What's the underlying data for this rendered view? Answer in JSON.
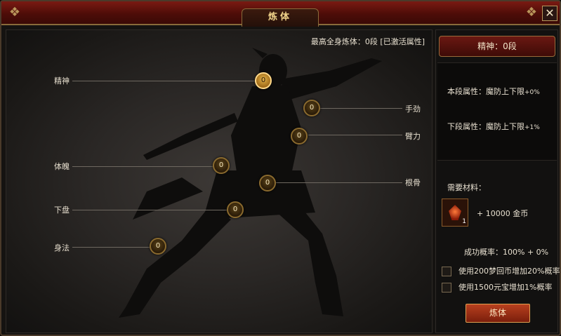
{
  "window": {
    "title": "炼体",
    "close_icon": "close-icon"
  },
  "summary": {
    "max_text": "最高全身炼体：0段 [已激活属性]"
  },
  "stats": [
    {
      "label": "精神",
      "value": "0"
    },
    {
      "label": "手劲",
      "value": "0"
    },
    {
      "label": "臂力",
      "value": "0"
    },
    {
      "label": "体魄",
      "value": "0"
    },
    {
      "label": "根骨",
      "value": "0"
    },
    {
      "label": "下盘",
      "value": "0"
    },
    {
      "label": "身法",
      "value": "0"
    }
  ],
  "side": {
    "header": "精神：0段",
    "current_attr_label": "本段属性：魔防上下限",
    "current_attr_pct": "+0%",
    "next_attr_label": "下段属性：魔防上下限",
    "next_attr_pct": "+1%",
    "materials_title": "需要材料：",
    "item_count": "1",
    "gold_cost": "+  10000 金币",
    "success_rate": "成功概率：100% + 0%",
    "option1": "使用200梦回币增加20%概率",
    "option2": "使用1500元宝增加1%概率",
    "refine_button": "炼体"
  },
  "colors": {
    "title_red": "#5a0f0a",
    "gold_border": "#8a6a3a",
    "active_node": "#e2b34a"
  }
}
